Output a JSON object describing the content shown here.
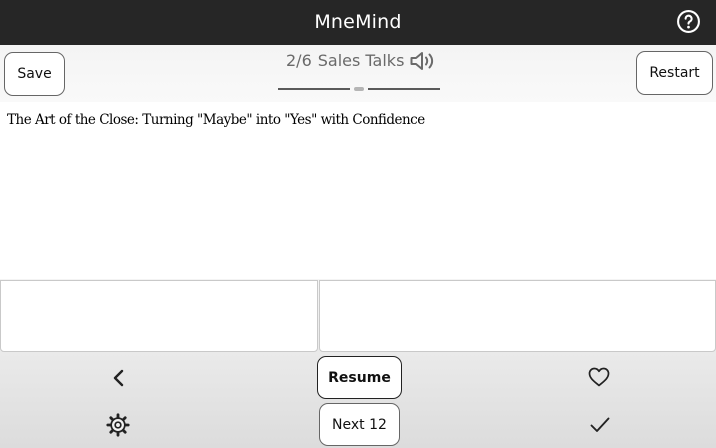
{
  "app": {
    "title": "MneMind"
  },
  "header": {
    "save_label": "Save",
    "restart_label": "Restart",
    "progress": "2/6",
    "deck_name": "Sales Talks"
  },
  "card": {
    "text": "The Art of the Close: Turning \"Maybe\" into \"Yes\" with Confidence"
  },
  "footer": {
    "resume_label": "Resume",
    "next_label": "Next 12"
  },
  "icons": {
    "help": "help-circle-icon",
    "speaker": "speaker-icon",
    "back": "chevron-left-icon",
    "favorite": "heart-icon",
    "settings": "gear-icon",
    "done": "check-icon"
  },
  "colors": {
    "titlebar": "#262626",
    "progress_text": "#6a6a6a"
  }
}
